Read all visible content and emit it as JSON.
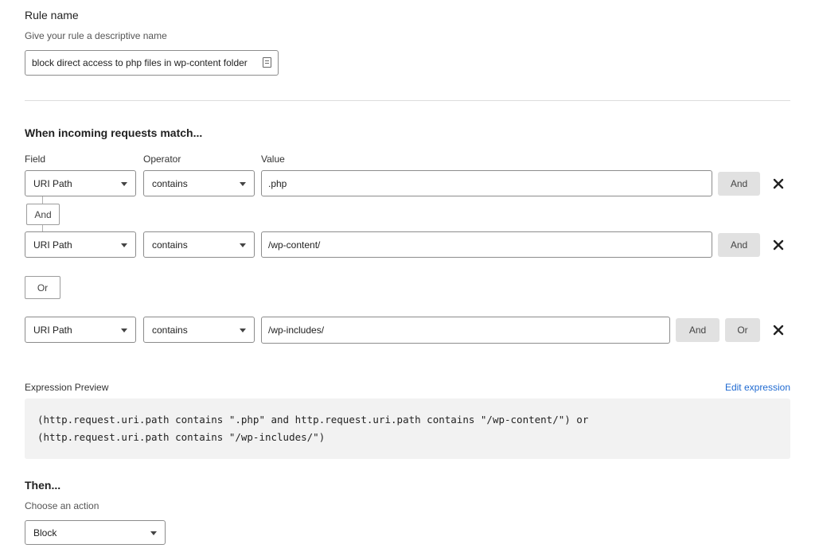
{
  "rule_name": {
    "label": "Rule name",
    "hint": "Give your rule a descriptive name",
    "value": "block direct access to php files in wp-content folder"
  },
  "match_section": {
    "title": "When incoming requests match...",
    "columns": {
      "field": "Field",
      "operator": "Operator",
      "value": "Value"
    },
    "rows": [
      {
        "field": "URI Path",
        "operator": "contains",
        "value": ".php",
        "and_label": "And"
      },
      {
        "field": "URI Path",
        "operator": "contains",
        "value": "/wp-content/",
        "and_label": "And"
      },
      {
        "field": "URI Path",
        "operator": "contains",
        "value": "/wp-includes/",
        "and_label": "And",
        "or_label": "Or"
      }
    ],
    "and_connector_label": "And",
    "or_group_label": "Or"
  },
  "expression_preview": {
    "label": "Expression Preview",
    "edit_link": "Edit expression",
    "lines": [
      "(http.request.uri.path contains \".php\" and http.request.uri.path contains \"/wp-content/\") or",
      "(http.request.uri.path contains \"/wp-includes/\")"
    ]
  },
  "then_section": {
    "title": "Then...",
    "hint": "Choose an action",
    "action": "Block"
  },
  "icons": {
    "close": "close-icon",
    "caret": "chevron-down-icon",
    "field_addon": "password-manager-icon"
  }
}
